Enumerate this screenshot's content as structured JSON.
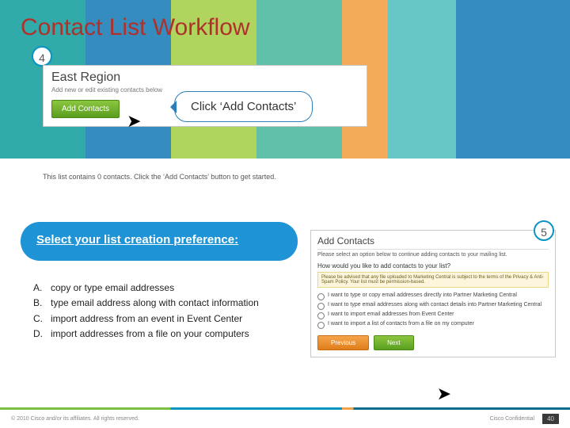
{
  "title": "Contact List Workflow",
  "step4": {
    "badge": "4",
    "panel_title": "East Region",
    "panel_sub": "Add new or edit existing contacts below",
    "button": "Add Contacts",
    "callout": "Click ‘Add Contacts’",
    "helper": "This list contains 0 contacts. Click the ‘Add Contacts’ button to get started."
  },
  "step5": {
    "badge": "5",
    "heading": "Select your list creation preference:",
    "options": [
      {
        "label": "A.",
        "text": "copy or type email addresses"
      },
      {
        "label": "B.",
        "text": "type email address along with contact information"
      },
      {
        "label": "C.",
        "text": "import address from an event in Event Center"
      },
      {
        "label": "D.",
        "text": "import addresses from a file on your computers"
      }
    ],
    "shot": {
      "title": "Add Contacts",
      "sub": "Please select an option below to continue adding contacts to your mailing list.",
      "question": "How would you like to add contacts to your list?",
      "warn": "Please be advised that any file uploaded to Marketing Central is subject to the terms of the Privacy & Anti-Spam Policy. Your list must be permission-based.",
      "radios": [
        "I want to type or copy email addresses directly into Partner Marketing Central",
        "I want to type email addresses along with contact details into Partner Marketing Central",
        "I want to import email addresses from Event Center",
        "I want to import a list of contacts from a file on my computer"
      ],
      "prev": "Previous",
      "next": "Next"
    }
  },
  "footer": {
    "copyright": "© 2010 Cisco and/or its affiliates. All rights reserved.",
    "confidential": "Cisco Confidential",
    "page": "40"
  }
}
